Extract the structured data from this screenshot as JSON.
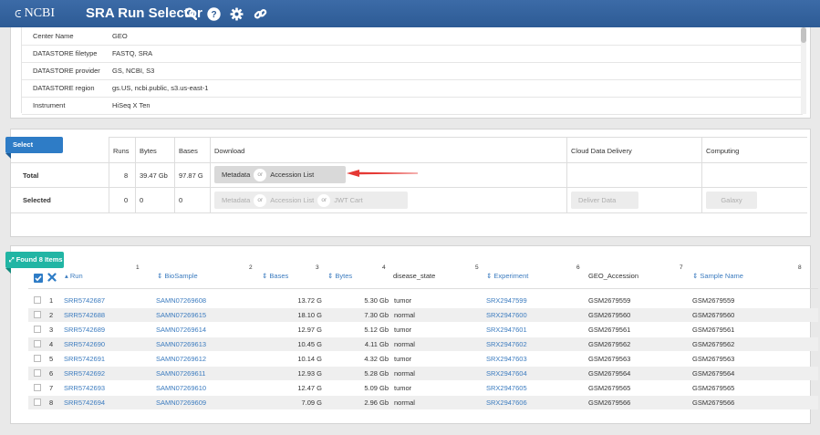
{
  "header": {
    "logo": "NCBI",
    "title": "SRA Run Selector"
  },
  "metadata_rows": [
    {
      "key": "Center Name",
      "value": "GEO"
    },
    {
      "key": "DATASTORE filetype",
      "value": "FASTQ, SRA"
    },
    {
      "key": "DATASTORE provider",
      "value": "GS, NCBI, S3"
    },
    {
      "key": "DATASTORE region",
      "value": "gs.US, ncbi.public, s3.us-east-1"
    },
    {
      "key": "Instrument",
      "value": "HiSeq X Ten"
    }
  ],
  "select_panel": {
    "tab": "Select",
    "headers": {
      "runs": "Runs",
      "bytes": "Bytes",
      "bases": "Bases",
      "download": "Download",
      "cloud": "Cloud Data Delivery",
      "computing": "Computing"
    },
    "total": {
      "label": "Total",
      "runs": "8",
      "bytes": "39.47 Gb",
      "bases": "97.87 G"
    },
    "selected": {
      "label": "Selected",
      "runs": "0",
      "bytes": "0",
      "bases": "0"
    },
    "buttons": {
      "metadata": "Metadata",
      "or": "or",
      "accession_list": "Accession List",
      "jwt_cart": "JWT Cart",
      "deliver_data": "Deliver Data",
      "galaxy": "Galaxy"
    },
    "annotation_arrow_color": "#e53935"
  },
  "results": {
    "tab": "Found 8 Items",
    "columns": [
      {
        "label": "Run",
        "num": "1"
      },
      {
        "label": "BioSample",
        "num": "2"
      },
      {
        "label": "Bases",
        "num": "3"
      },
      {
        "label": "Bytes",
        "num": "4"
      },
      {
        "label": "disease_state",
        "num": "5"
      },
      {
        "label": "Experiment",
        "num": "6"
      },
      {
        "label": "GEO_Accession",
        "num": "7"
      },
      {
        "label": "Sample Name",
        "num": "8"
      }
    ],
    "rows": [
      {
        "n": "1",
        "run": "SRR5742687",
        "biosample": "SAMN07269608",
        "bases": "13.72 G",
        "bytes": "5.30 Gb",
        "disease": "tumor",
        "experiment": "SRX2947599",
        "geo": "GSM2679559",
        "sample": "GSM2679559"
      },
      {
        "n": "2",
        "run": "SRR5742688",
        "biosample": "SAMN07269615",
        "bases": "18.10 G",
        "bytes": "7.30 Gb",
        "disease": "normal",
        "experiment": "SRX2947600",
        "geo": "GSM2679560",
        "sample": "GSM2679560"
      },
      {
        "n": "3",
        "run": "SRR5742689",
        "biosample": "SAMN07269614",
        "bases": "12.97 G",
        "bytes": "5.12 Gb",
        "disease": "tumor",
        "experiment": "SRX2947601",
        "geo": "GSM2679561",
        "sample": "GSM2679561"
      },
      {
        "n": "4",
        "run": "SRR5742690",
        "biosample": "SAMN07269613",
        "bases": "10.45 G",
        "bytes": "4.11 Gb",
        "disease": "normal",
        "experiment": "SRX2947602",
        "geo": "GSM2679562",
        "sample": "GSM2679562"
      },
      {
        "n": "5",
        "run": "SRR5742691",
        "biosample": "SAMN07269612",
        "bases": "10.14 G",
        "bytes": "4.32 Gb",
        "disease": "tumor",
        "experiment": "SRX2947603",
        "geo": "GSM2679563",
        "sample": "GSM2679563"
      },
      {
        "n": "6",
        "run": "SRR5742692",
        "biosample": "SAMN07269611",
        "bases": "12.93 G",
        "bytes": "5.28 Gb",
        "disease": "normal",
        "experiment": "SRX2947604",
        "geo": "GSM2679564",
        "sample": "GSM2679564"
      },
      {
        "n": "7",
        "run": "SRR5742693",
        "biosample": "SAMN07269610",
        "bases": "12.47 G",
        "bytes": "5.09 Gb",
        "disease": "tumor",
        "experiment": "SRX2947605",
        "geo": "GSM2679565",
        "sample": "GSM2679565"
      },
      {
        "n": "8",
        "run": "SRR5742694",
        "biosample": "SAMN07269609",
        "bases": "7.09 G",
        "bytes": "2.96 Gb",
        "disease": "normal",
        "experiment": "SRX2947606",
        "geo": "GSM2679566",
        "sample": "GSM2679566"
      }
    ]
  },
  "icons": [
    "search-icon",
    "help-icon",
    "gear-icon",
    "link-icon",
    "checkbox-icon",
    "clear-icon"
  ]
}
